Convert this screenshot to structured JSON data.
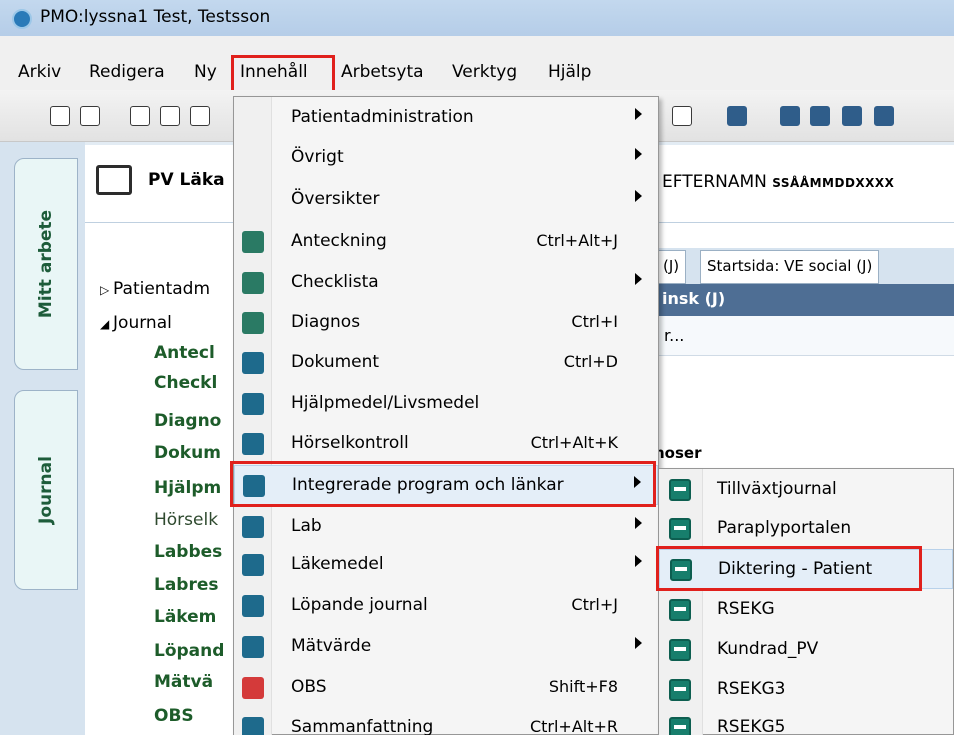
{
  "window": {
    "title": "PMO:lyssna1  Test, Testsson"
  },
  "menubar": {
    "items": [
      {
        "label": "Arkiv"
      },
      {
        "label": "Redigera"
      },
      {
        "label": "Ny"
      },
      {
        "label": "Innehåll",
        "active": true
      },
      {
        "label": "Arbetsyta"
      },
      {
        "label": "Verktyg"
      },
      {
        "label": "Hjälp"
      }
    ]
  },
  "sidetabs": {
    "top": "Mitt arbete",
    "bottom": "Journal"
  },
  "header": {
    "unit": "PV Läka",
    "patient_name": "EFTERNAMN",
    "patient_id": "SSÅÅMMDDXXXX"
  },
  "tree": {
    "patientadm": "Patientadm",
    "journal": "Journal",
    "items": [
      "Antecl",
      "Checkl",
      "Diagno",
      "Dokum",
      "Hjälpm",
      "Hörselk",
      "Labbes",
      "Labres",
      "Läkem",
      "Löpand",
      "Mätvä",
      "OBS"
    ]
  },
  "right_panel": {
    "tab_j": "(J)",
    "tab_startsida": "Startsida: VE social (J)",
    "bar_title": "insk (J)",
    "row_text": "r...",
    "noser": "noser"
  },
  "menu": {
    "items": [
      {
        "label": "Patientadministration",
        "shortcut": "",
        "submenu": true,
        "icon": ""
      },
      {
        "label": "Övrigt",
        "shortcut": "",
        "submenu": true,
        "icon": ""
      },
      {
        "label": "Översikter",
        "shortcut": "",
        "submenu": true,
        "icon": ""
      },
      {
        "label": "Anteckning",
        "shortcut": "Ctrl+Alt+J",
        "submenu": false,
        "icon": "note-icon"
      },
      {
        "label": "Checklista",
        "shortcut": "",
        "submenu": true,
        "icon": "checklist-icon"
      },
      {
        "label": "Diagnos",
        "shortcut": "Ctrl+I",
        "submenu": false,
        "icon": "diagnosis-icon"
      },
      {
        "label": "Dokument",
        "shortcut": "Ctrl+D",
        "submenu": false,
        "icon": "document-icon"
      },
      {
        "label": "Hjälpmedel/Livsmedel",
        "shortcut": "",
        "submenu": false,
        "icon": "aids-icon"
      },
      {
        "label": "Hörselkontroll",
        "shortcut": "Ctrl+Alt+K",
        "submenu": false,
        "icon": "headphones-icon"
      },
      {
        "label": "Integrerade program och länkar",
        "shortcut": "",
        "submenu": true,
        "icon": "globe-icon",
        "hover": true
      },
      {
        "label": "Lab",
        "shortcut": "",
        "submenu": true,
        "icon": "test-tube-icon"
      },
      {
        "label": "Läkemedel",
        "shortcut": "",
        "submenu": true,
        "icon": "pill-icon"
      },
      {
        "label": "Löpande journal",
        "shortcut": "Ctrl+J",
        "submenu": false,
        "icon": "folder-icon"
      },
      {
        "label": "Mätvärde",
        "shortcut": "",
        "submenu": true,
        "icon": "ruler-icon"
      },
      {
        "label": "OBS",
        "shortcut": "Shift+F8",
        "submenu": false,
        "icon": "warning-icon"
      },
      {
        "label": "Sammanfattning",
        "shortcut": "Ctrl+Alt+R",
        "submenu": false,
        "icon": "summary-icon"
      }
    ]
  },
  "submenu": {
    "items": [
      {
        "label": "Tillväxtjournal"
      },
      {
        "label": "Paraplyportalen"
      },
      {
        "label": "Diktering - Patient",
        "hover": true
      },
      {
        "label": "RSEKG"
      },
      {
        "label": "Kundrad_PV"
      },
      {
        "label": "RSEKG3"
      },
      {
        "label": "RSEKG5"
      }
    ]
  },
  "colors": {
    "highlight_box": "#e0201c",
    "tree_green": "#1d5c2a",
    "bar_blue": "#4e6e94"
  }
}
